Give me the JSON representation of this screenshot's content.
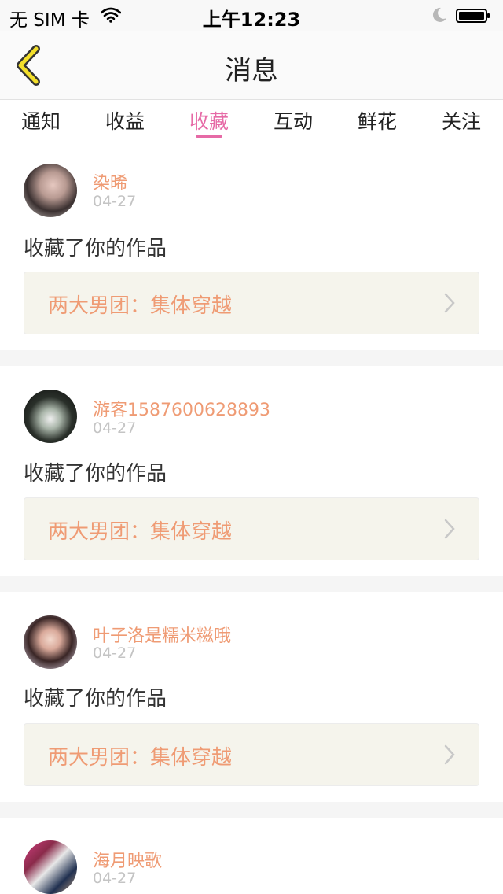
{
  "status_bar": {
    "carrier": "无 SIM 卡",
    "time": "上午12:23"
  },
  "nav": {
    "title": "消息"
  },
  "tabs": [
    {
      "label": "通知",
      "active": false
    },
    {
      "label": "收益",
      "active": false
    },
    {
      "label": "收藏",
      "active": true
    },
    {
      "label": "互动",
      "active": false
    },
    {
      "label": "鲜花",
      "active": false
    },
    {
      "label": "关注",
      "active": false
    }
  ],
  "colors": {
    "accent": "#e66aa6",
    "username": "#ef9b74",
    "work_bg": "#f5f4ec"
  },
  "items": [
    {
      "user": "染晞",
      "date": "04-27",
      "action": "收藏了你的作品",
      "work": "两大男团：集体穿越"
    },
    {
      "user": "游客1587600628893",
      "date": "04-27",
      "action": "收藏了你的作品",
      "work": "两大男团：集体穿越"
    },
    {
      "user": "叶子洛是糯米糍哦",
      "date": "04-27",
      "action": "收藏了你的作品",
      "work": "两大男团：集体穿越"
    },
    {
      "user": "海月映歌",
      "date": "04-27"
    }
  ]
}
